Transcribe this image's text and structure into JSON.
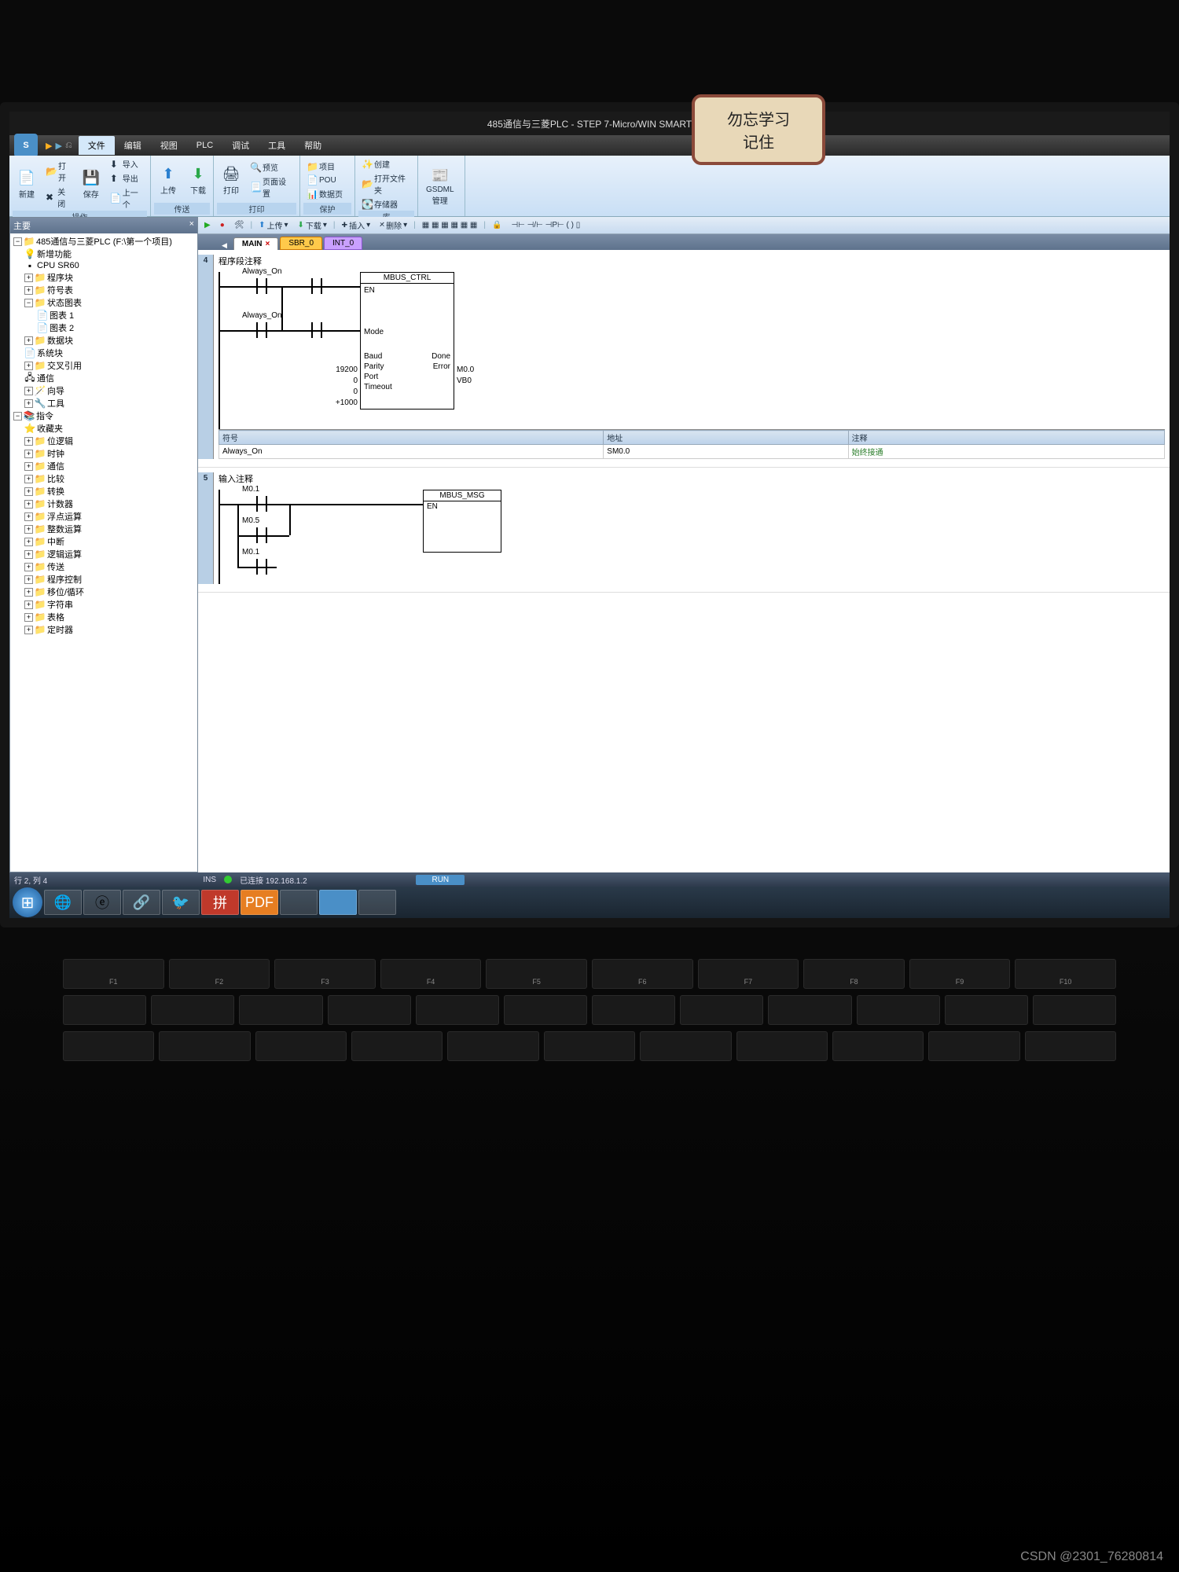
{
  "sticker": {
    "line1": "勿忘学习",
    "line2": "记住"
  },
  "title": "485通信与三菱PLC - STEP 7-Micro/WIN SMART",
  "menu": {
    "file": "文件",
    "edit": "编辑",
    "view": "视图",
    "plc": "PLC",
    "debug": "调试",
    "tools": "工具",
    "help": "帮助"
  },
  "ribbon": {
    "ops_group": "操作",
    "transfer_group": "传送",
    "print_group": "打印",
    "protect_group": "保护",
    "lib_group": "库",
    "gsdml_group": "",
    "new": "新建",
    "open": "打开",
    "close": "关闭",
    "save": "保存",
    "import": "导入",
    "export": "导出",
    "prev": "上一个",
    "upload": "上传",
    "download": "下载",
    "print": "打印",
    "preview": "预览",
    "pagesetup": "页面设置",
    "project": "项目",
    "pou": "POU",
    "datapage": "数据页",
    "create": "创建",
    "open_folder": "打开文件夹",
    "storage": "存储器",
    "gsdml": "GSDML\n管理"
  },
  "edit_tb": {
    "upload": "上传",
    "download": "下载",
    "insert": "插入",
    "delete": "删除"
  },
  "tabs": {
    "main": "MAIN",
    "sbr": "SBR_0",
    "int": "INT_0"
  },
  "tree": {
    "root": "485通信与三菱PLC (F:\\第一个项目)",
    "new_feature": "新增功能",
    "cpu": "CPU SR60",
    "prog_block": "程序块",
    "symbol_table": "符号表",
    "status_chart": "状态图表",
    "chart1": "图表 1",
    "chart2": "图表 2",
    "data_block": "数据块",
    "sys_block": "系统块",
    "xref": "交叉引用",
    "comm": "通信",
    "wizard": "向导",
    "tools": "工具",
    "instructions": "指令",
    "favorites": "收藏夹",
    "bit_logic": "位逻辑",
    "clock": "时钟",
    "communication": "通信",
    "compare": "比较",
    "convert": "转换",
    "counters": "计数器",
    "float_math": "浮点运算",
    "int_math": "整数运算",
    "interrupt": "中断",
    "logical": "逻辑运算",
    "move": "传送",
    "prog_control": "程序控制",
    "shift_rotate": "移位/循环",
    "string": "字符串",
    "table": "表格",
    "timers": "定时器"
  },
  "network4": {
    "num": "4",
    "title": "程序段注释",
    "contact1": "Always_On",
    "contact2": "Always_On",
    "block": "MBUS_CTRL",
    "en": "EN",
    "mode": "Mode",
    "baud_v": "19200",
    "baud": "Baud",
    "parity_v": "0",
    "parity": "Parity",
    "port_v": "0",
    "port": "Port",
    "timeout_v": "+1000",
    "timeout": "Timeout",
    "done": "Done",
    "done_v": "M0.0",
    "error": "Error",
    "error_v": "VB0"
  },
  "sym_table": {
    "h1": "符号",
    "h2": "地址",
    "h3": "注释",
    "r1c1": "Always_On",
    "r1c2": "SM0.0",
    "r1c3": "始终接通"
  },
  "network5": {
    "num": "5",
    "title": "输入注释",
    "c1": "M0.1",
    "c2": "M0.5",
    "c3": "M0.1",
    "block": "MBUS_MSG",
    "en": "EN"
  },
  "status": {
    "rowcol": "行 2, 列 4",
    "ins": "INS",
    "connected": "已连接 192.168.1.2",
    "run": "RUN"
  },
  "watermark": "CSDN @2301_76280814",
  "fkeys": [
    "F1",
    "F2",
    "F3",
    "F4",
    "F5",
    "F6",
    "F7",
    "F8",
    "F9",
    "F10"
  ]
}
